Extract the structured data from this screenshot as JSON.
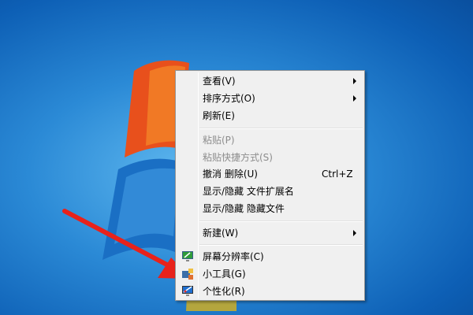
{
  "menu": {
    "items": [
      {
        "label": "查看(V)",
        "submenu": true
      },
      {
        "label": "排序方式(O)",
        "submenu": true
      },
      {
        "label": "刷新(E)"
      },
      {
        "label": "粘贴(P)",
        "disabled": true
      },
      {
        "label": "粘贴快捷方式(S)",
        "disabled": true
      },
      {
        "label": "撤消 删除(U)",
        "shortcut": "Ctrl+Z"
      },
      {
        "label": "显示/隐藏 文件扩展名"
      },
      {
        "label": "显示/隐藏 隐藏文件"
      },
      {
        "label": "新建(W)",
        "submenu": true
      },
      {
        "label": "屏幕分辨率(C)",
        "icon": "monitor-resolution-icon"
      },
      {
        "label": "小工具(G)",
        "icon": "gadgets-icon"
      },
      {
        "label": "个性化(R)",
        "icon": "personalize-icon"
      }
    ]
  },
  "colors": {
    "desktop": "#2b8ad6",
    "arrow": "#e8221b"
  }
}
